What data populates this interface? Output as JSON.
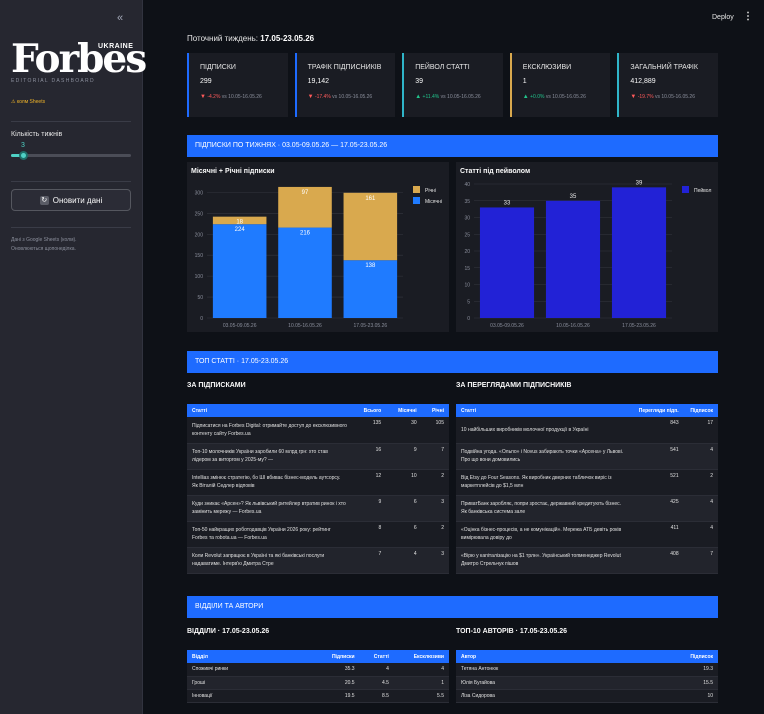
{
  "sidebar": {
    "collapse_glyph": "«",
    "logo": "Forbes",
    "logo_region": "UKRAINE",
    "logo_subtitle": "EDITORIAL DASHBOARD",
    "sheets_link": "⚠ колм Sheets",
    "weeks_label": "Кількість тижнів",
    "weeks_value": "3",
    "weeks_fraction": 0.1,
    "refresh_label": "Оновити дані",
    "note_line1": "Дані з Google Sheets (колм).",
    "note_line2": "Оновлюються щопонеділка."
  },
  "topbar": {
    "deploy_label": "Deploy",
    "menu_glyph": "⋮"
  },
  "current_week": {
    "label": "Поточний тиждень:",
    "value": "17.05-23.05.26"
  },
  "colors": {
    "accent": "#1e6bff",
    "gold": "#d9a94e",
    "blue_bar": "#1f7bff",
    "dark_blue_bar": "#2222d6",
    "teal": "#4fd1c5",
    "negative": "#ff5a5a",
    "positive": "#21c38b"
  },
  "kpis": [
    {
      "label": "ПІДПИСКИ",
      "value": "299",
      "arrow": "▼",
      "delta": "-4.2%",
      "trend": "neg",
      "compare": "vs 10.05-16.05.26",
      "border": "#1e6bff"
    },
    {
      "label": "ТРАФІК ПІДПИСНИКІВ",
      "value": "19,142",
      "arrow": "▼",
      "delta": "-17.4%",
      "trend": "neg",
      "compare": "vs 10.05-16.05.26",
      "border": "#1e6bff"
    },
    {
      "label": "ПЕЙВОЛ СТАТТІ",
      "value": "39",
      "arrow": "▲",
      "delta": "+11.4%",
      "trend": "pos",
      "compare": "vs 10.05-16.05.26",
      "border": "#2fb5c9"
    },
    {
      "label": "ЕКСКЛЮЗИВИ",
      "value": "1",
      "arrow": "▲",
      "delta": "+0.0%",
      "trend": "pos",
      "compare": "vs 10.05-16.05.26",
      "border": "#d9a94e"
    },
    {
      "label": "ЗАГАЛЬНИЙ ТРАФІК",
      "value": "412,889",
      "arrow": "▼",
      "delta": "-19.7%",
      "trend": "neg",
      "compare": "vs 10.05-16.05.26",
      "border": "#2fb5c9"
    }
  ],
  "banners": {
    "subs": "ПІДПИСКИ ПО ТИЖНЯХ · 03.05-09.05.26 — 17.05-23.05.26",
    "top": "ТОП СТАТТІ · 17.05-23.05.26",
    "dept": "ВІДДІЛИ ТА АВТОРИ"
  },
  "chart_data": [
    {
      "type": "bar",
      "title": "Місячні + Річні підписки",
      "categories": [
        "03.05-09.05.26",
        "10.05-16.05.26",
        "17.05-23.05.26"
      ],
      "series": [
        {
          "name": "Місячні",
          "values": [
            224,
            216,
            138
          ],
          "color": "#1f7bff"
        },
        {
          "name": "Річні",
          "values": [
            18,
            97,
            161
          ],
          "color": "#d9a94e"
        }
      ],
      "ylim": [
        0,
        320
      ],
      "yticks": [
        0,
        50,
        100,
        150,
        200,
        250,
        300
      ],
      "legend": "top-right",
      "stacked": true
    },
    {
      "type": "bar",
      "title": "Статті під пейволом",
      "categories": [
        "03.05-09.05.26",
        "10.05-16.05.26",
        "17.05-23.05.26"
      ],
      "series": [
        {
          "name": "Пейвол",
          "values": [
            33,
            35,
            39
          ],
          "color": "#2222d6"
        }
      ],
      "ylim": [
        0,
        40
      ],
      "yticks": [
        0,
        5,
        10,
        15,
        20,
        25,
        30,
        35,
        40
      ],
      "legend": "top-right"
    }
  ],
  "top_subs": {
    "title": "ЗА ПІДПИСКАМИ",
    "headers": [
      "Статті",
      "Всього",
      "Місячні",
      "Річні"
    ],
    "rows": [
      [
        "Підписатися на Forbes Digital: отримайте доступ до ексклюзивного контенту сайту Forbes.ua",
        "135",
        "30",
        "105"
      ],
      [
        "Топ-10 молочників України заробили 60 млрд грн: хто став лідером за виторгом у 2025-му? —",
        "16",
        "9",
        "7"
      ],
      [
        "Intellias змінює стратегію, бо ШІ вбиває бізнес-модель аутсорсу. Як Віталій Седлер відповів",
        "12",
        "10",
        "2"
      ],
      [
        "Куди зникає «Арсен»? Як львівський ритейлер втратив ринок і хто замінить мережу — Forbes.ua",
        "9",
        "6",
        "3"
      ],
      [
        "Топ-50 найкращих роботодавців України 2026 року: рейтинг Forbes та robota.ua — Forbes.ua",
        "8",
        "6",
        "2"
      ],
      [
        "Коли Revolut запрацює в Україні та які банківські послуги надаватиме. Інтерв'ю Дмитра Стре",
        "7",
        "4",
        "3"
      ]
    ]
  },
  "top_views": {
    "title": "ЗА ПЕРЕГЛЯДАМИ ПІДПИСНИКІВ",
    "headers": [
      "Статті",
      "Перегляди підп.",
      "Підписок"
    ],
    "rows": [
      [
        "10 найбільших виробників молочної продукції в Україні",
        "843",
        "17"
      ],
      [
        "Подвійна угода. «Ольпо» і Novus забирають точки «Арсена» у Львові. Про що вони домовились",
        "541",
        "4"
      ],
      [
        "Від Etsy до Four Seasons. Як виробник дверних табличок виріс із маркетплейсів до $1,5 млн",
        "521",
        "2"
      ],
      [
        "ПриватБанк заробляє, попри зростає, державний кредитують бізнес. Як банківська система зале",
        "425",
        "4"
      ],
      [
        "«Оцінка бізнес-процесів, а не комунікацій». Мережа АТБ девіть років вимірювала довіру до",
        "411",
        "4"
      ],
      [
        "«Вірю у капіталізацію на $1 трлн». Український топменеджер Revolut Дмитро Стрельчук пішов",
        "408",
        "7"
      ]
    ]
  },
  "depts": {
    "title": "ВІДДІЛИ · 17.05-23.05.26",
    "headers": [
      "Відділ",
      "Підписки",
      "Статті",
      "Ексклюзиви"
    ],
    "rows": [
      [
        "Споживчі ринки",
        "35.3",
        "4",
        "4"
      ],
      [
        "Гроші",
        "20.5",
        "4.5",
        "1"
      ],
      [
        "Інновації",
        "19.5",
        "8.5",
        "5.5"
      ]
    ]
  },
  "authors": {
    "title": "ТОП-10 АВТОРІВ · 17.05-23.05.26",
    "headers": [
      "Автор",
      "Підписок"
    ],
    "rows": [
      [
        "Тетяна Антонюк",
        "19.3"
      ],
      [
        "Юлія Бугайова",
        "15.5"
      ],
      [
        "Ліза Сидорова",
        "10"
      ]
    ]
  }
}
